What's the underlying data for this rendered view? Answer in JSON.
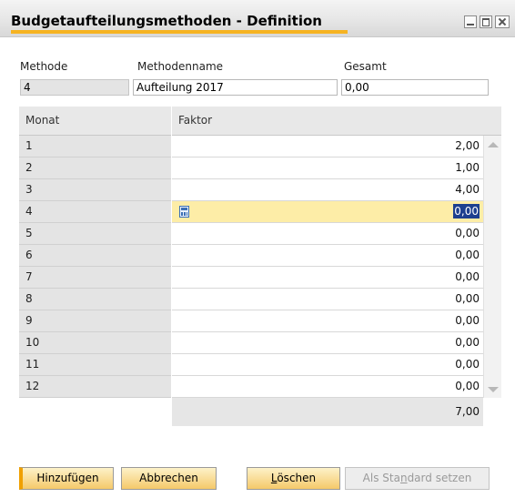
{
  "window": {
    "title": "Budgetaufteilungsmethoden - Definition",
    "accent_color": "#f6b322",
    "controls": [
      "minimize-icon",
      "maximize-icon",
      "close-icon"
    ]
  },
  "form": {
    "method_label": "Methode",
    "method_value": "4",
    "name_label": "Methodenname",
    "name_value": "Aufteilung 2017",
    "total_label": "Gesamt",
    "total_value": "0,00"
  },
  "grid": {
    "columns": [
      "Monat",
      "Faktor"
    ],
    "rows": [
      {
        "month": "1",
        "factor": "2,00"
      },
      {
        "month": "2",
        "factor": "1,00"
      },
      {
        "month": "3",
        "factor": "4,00"
      },
      {
        "month": "4",
        "factor": "0,00"
      },
      {
        "month": "5",
        "factor": "0,00"
      },
      {
        "month": "6",
        "factor": "0,00"
      },
      {
        "month": "7",
        "factor": "0,00"
      },
      {
        "month": "8",
        "factor": "0,00"
      },
      {
        "month": "9",
        "factor": "0,00"
      },
      {
        "month": "10",
        "factor": "0,00"
      },
      {
        "month": "11",
        "factor": "0,00"
      },
      {
        "month": "12",
        "factor": "0,00"
      }
    ],
    "active_row": 4,
    "sum": "7,00"
  },
  "buttons": {
    "add": "Hinzufügen",
    "cancel": "Abbrechen",
    "delete_prefix": "",
    "delete_underlined": "L",
    "delete_rest": "öschen",
    "standard_prefix": "Als Sta",
    "standard_underlined": "n",
    "standard_rest": "dard setzen"
  }
}
